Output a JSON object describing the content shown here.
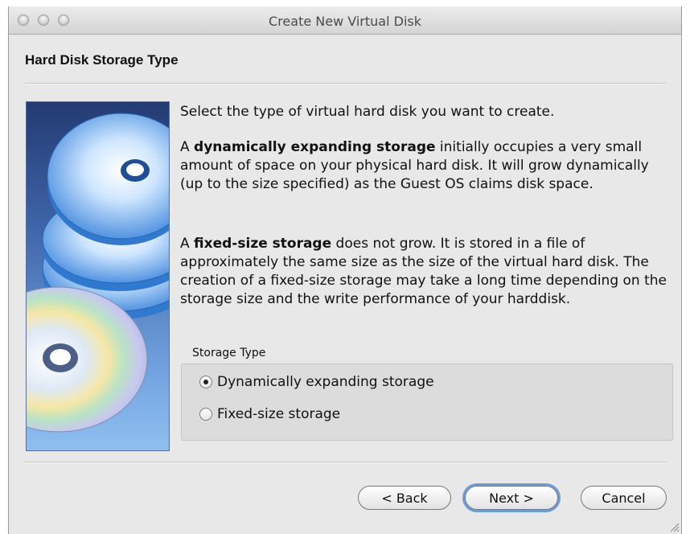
{
  "window": {
    "title": "Create New Virtual Disk",
    "section_title": "Hard Disk Storage Type"
  },
  "description": {
    "intro": "Select the type of virtual hard disk you want to create.",
    "dynamic_prefix": "A ",
    "dynamic_bold": "dynamically expanding storage",
    "dynamic_rest": " initially occupies a very small amount of space on your physical hard disk. It will grow dynamically (up to the size specified) as the Guest OS claims disk space.",
    "fixed_prefix": "A ",
    "fixed_bold": "fixed-size storage",
    "fixed_rest": " does not grow. It is stored in a file of approximately the same size as the size of the virtual hard disk. The creation of a fixed-size storage may take a long time depending on the storage size and the write performance of your harddisk."
  },
  "storage_type": {
    "label": "Storage Type",
    "options": [
      {
        "label": "Dynamically expanding storage",
        "selected": true
      },
      {
        "label": "Fixed-size storage",
        "selected": false
      }
    ]
  },
  "buttons": {
    "back": "< Back",
    "next": "Next >",
    "cancel": "Cancel"
  },
  "colors": {
    "focus_ring": "#6c9bd8",
    "side_panel_top": "#233b72",
    "side_panel_bottom": "#8fbff0"
  }
}
